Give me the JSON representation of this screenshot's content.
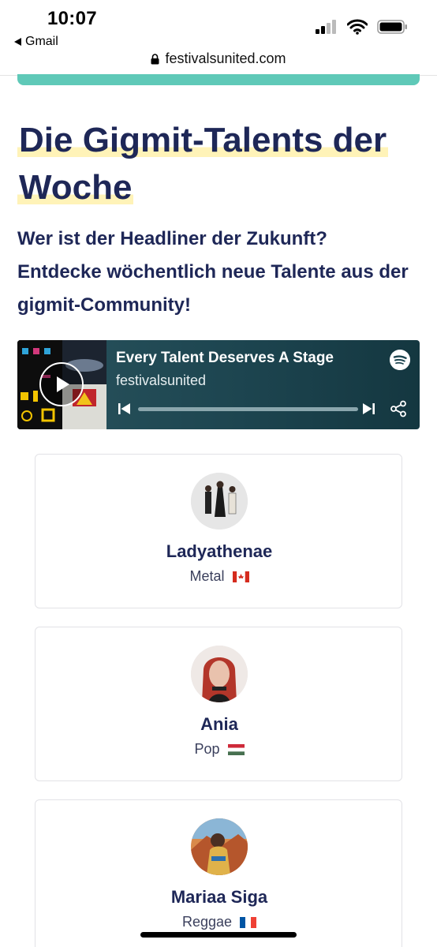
{
  "status_bar": {
    "time": "10:07",
    "back_app": "Gmail",
    "url": "festivalsunited.com",
    "icons": [
      "cellular-signal-icon",
      "wifi-icon",
      "battery-icon",
      "lock-icon"
    ]
  },
  "colors": {
    "headline": "#1e2757",
    "highlight": "#fff3b8",
    "teal_strip": "#5fc9b8",
    "player_bg": "#1d4550"
  },
  "article": {
    "headline_line1": "Die Gigmit-Talents der",
    "headline_line2": "Woche",
    "subhead": "Wer ist der Headliner der Zukunft? Entdecke wöchentlich neue Talente aus der gigmit-Community!"
  },
  "player": {
    "track_title": "Every Talent Deserves A Stage",
    "artist": "festivalsunited",
    "progress": 0.0,
    "icons": [
      "play-icon",
      "spotify-icon",
      "previous-track-icon",
      "next-track-icon",
      "share-icon"
    ]
  },
  "talents": [
    {
      "name": "Ladyathenae",
      "genre": "Metal",
      "flag": "canada-flag-icon"
    },
    {
      "name": "Ania",
      "genre": "Pop",
      "flag": "hungary-flag-icon"
    },
    {
      "name": "Mariaa Siga",
      "genre": "Reggae",
      "flag": "france-flag-icon"
    }
  ]
}
